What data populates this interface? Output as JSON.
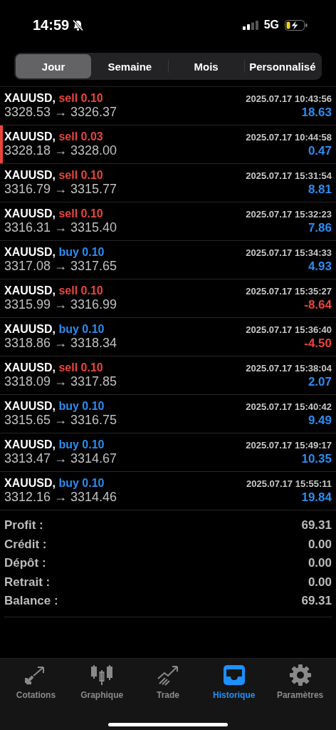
{
  "status_bar": {
    "time": "14:59",
    "network": "5G"
  },
  "period_tabs": [
    {
      "label": "Jour",
      "selected": true
    },
    {
      "label": "Semaine",
      "selected": false
    },
    {
      "label": "Mois",
      "selected": false
    },
    {
      "label": "Personnalisé",
      "selected": false
    }
  ],
  "trades": [
    {
      "symbol": "XAUUSD,",
      "kind": "sell",
      "order": "sell 0.10",
      "time": "2025.07.17 10:43:56",
      "prices": "3328.53 → 3326.37",
      "profit": "18.63",
      "color": "#2d8cf0",
      "selected": false
    },
    {
      "symbol": "XAUUSD,",
      "kind": "sell",
      "order": "sell 0.03",
      "time": "2025.07.17 10:44:58",
      "prices": "3328.18 → 3328.00",
      "profit": "0.47",
      "color": "#2d8cf0",
      "selected": true
    },
    {
      "symbol": "XAUUSD,",
      "kind": "sell",
      "order": "sell 0.10",
      "time": "2025.07.17 15:31:54",
      "prices": "3316.79 → 3315.77",
      "profit": "8.81",
      "color": "#2d8cf0",
      "selected": false
    },
    {
      "symbol": "XAUUSD,",
      "kind": "sell",
      "order": "sell 0.10",
      "time": "2025.07.17 15:32:23",
      "prices": "3316.31 → 3315.40",
      "profit": "7.86",
      "color": "#2d8cf0",
      "selected": false
    },
    {
      "symbol": "XAUUSD,",
      "kind": "buy",
      "order": "buy 0.10",
      "time": "2025.07.17 15:34:33",
      "prices": "3317.08 → 3317.65",
      "profit": "4.93",
      "color": "#2d8cf0",
      "selected": false
    },
    {
      "symbol": "XAUUSD,",
      "kind": "sell",
      "order": "sell 0.10",
      "time": "2025.07.17 15:35:27",
      "prices": "3315.99 → 3316.99",
      "profit": "-8.64",
      "color": "#e8453c",
      "selected": false
    },
    {
      "symbol": "XAUUSD,",
      "kind": "buy",
      "order": "buy 0.10",
      "time": "2025.07.17 15:36:40",
      "prices": "3318.86 → 3318.34",
      "profit": "-4.50",
      "color": "#e8453c",
      "selected": false
    },
    {
      "symbol": "XAUUSD,",
      "kind": "sell",
      "order": "sell 0.10",
      "time": "2025.07.17 15:38:04",
      "prices": "3318.09 → 3317.85",
      "profit": "2.07",
      "color": "#2d8cf0",
      "selected": false
    },
    {
      "symbol": "XAUUSD,",
      "kind": "buy",
      "order": "buy 0.10",
      "time": "2025.07.17 15:40:42",
      "prices": "3315.65 → 3316.75",
      "profit": "9.49",
      "color": "#2d8cf0",
      "selected": false
    },
    {
      "symbol": "XAUUSD,",
      "kind": "buy",
      "order": "buy 0.10",
      "time": "2025.07.17 15:49:17",
      "prices": "3313.47 → 3314.67",
      "profit": "10.35",
      "color": "#2d8cf0",
      "selected": false
    },
    {
      "symbol": "XAUUSD,",
      "kind": "buy",
      "order": "buy 0.10",
      "time": "2025.07.17 15:55:11",
      "prices": "3312.16 → 3314.46",
      "profit": "19.84",
      "color": "#2d8cf0",
      "selected": false
    }
  ],
  "summary": [
    {
      "label": "Profit :",
      "value": "69.31"
    },
    {
      "label": "Crédit :",
      "value": "0.00"
    },
    {
      "label": "Dépôt :",
      "value": "0.00"
    },
    {
      "label": "Retrait :",
      "value": "0.00"
    },
    {
      "label": "Balance :",
      "value": "69.31"
    }
  ],
  "tab_bar": [
    {
      "label": "Cotations",
      "kind": "quotes",
      "selected": false
    },
    {
      "label": "Graphique",
      "kind": "chart",
      "selected": false
    },
    {
      "label": "Trade",
      "kind": "trade",
      "selected": false
    },
    {
      "label": "Historique",
      "kind": "history",
      "selected": true
    },
    {
      "label": "Paramètres",
      "kind": "settings",
      "selected": false
    }
  ]
}
